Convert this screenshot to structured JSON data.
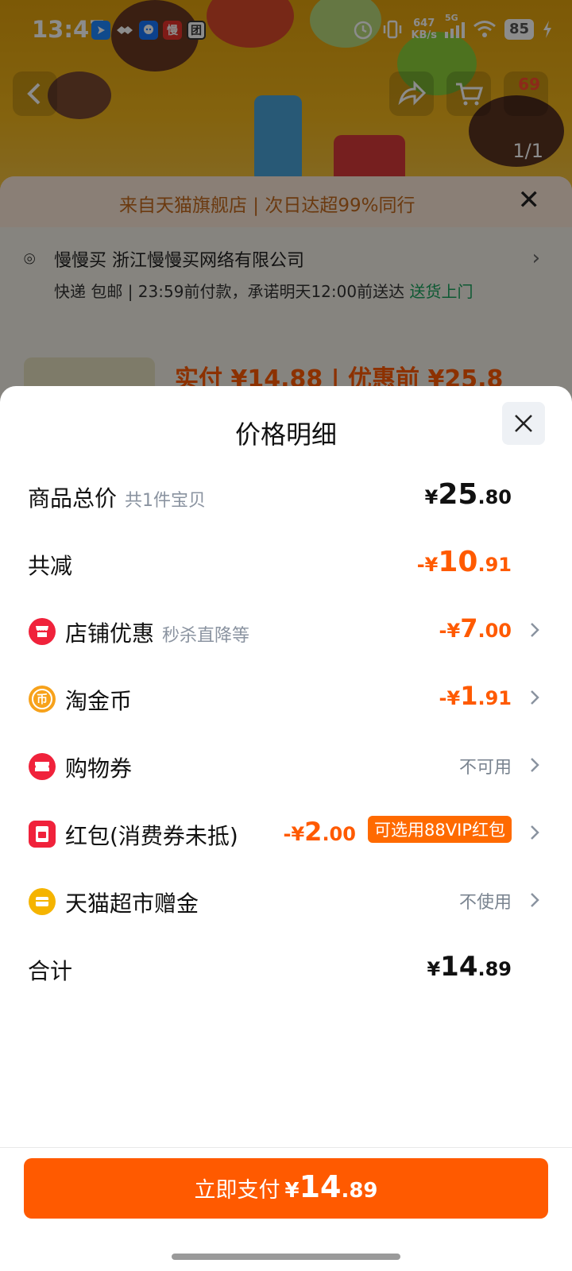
{
  "status_bar": {
    "time": "13:47",
    "net_speed": "647",
    "net_unit": "KB/s",
    "signal": "5G",
    "battery": "85",
    "app_icons": [
      "navigation-icon",
      "handshake-icon",
      "chat-icon",
      "manmanmai-icon",
      "tuan-icon"
    ],
    "app_icon_labels": [
      "慢",
      "团"
    ]
  },
  "background": {
    "pager": "1/1",
    "cart_badge": "69",
    "banner_text": "来自天猫旗舰店 | 次日达超99%同行",
    "address_line": "慢慢买 浙江慢慢买网络有限公司",
    "delivery_prefix": "快递 包邮 | 23:59前付款，承诺明天12:00前送达",
    "delivery_green": "送货上门",
    "price_preview": "实付 ¥14.88 | 优惠前 ¥25.8"
  },
  "sheet": {
    "title": "价格明细",
    "rows": {
      "total": {
        "label": "商品总价",
        "sub": "共1件宝贝",
        "yen": "¥",
        "int": "25",
        "dec": ".80"
      },
      "reduction": {
        "label": "共减",
        "yen": "-¥",
        "int": "10",
        "dec": ".91"
      },
      "shop": {
        "label": "店铺优惠",
        "sub": "秒杀直降等",
        "yen": "-¥",
        "int": "7",
        "dec": ".00",
        "icon": "shop-icon"
      },
      "coins": {
        "label": "淘金币",
        "yen": "-¥",
        "int": "1",
        "dec": ".91",
        "icon": "coin-icon",
        "icon_glyph": "币"
      },
      "voucher": {
        "label": "购物券",
        "value": "不可用",
        "icon": "ticket-icon"
      },
      "redpacket": {
        "label": "红包(消费券未抵)",
        "yen": "-¥",
        "int": "2",
        "dec": ".00",
        "tag": "可选用88VIP红包",
        "icon": "red-packet-icon"
      },
      "gift": {
        "label": "天猫超市赠金",
        "value": "不使用",
        "icon": "gift-card-icon"
      },
      "sum": {
        "label": "合计",
        "yen": "¥",
        "int": "14",
        "dec": ".89"
      }
    }
  },
  "footer": {
    "pay_label": "立即支付",
    "pay_yen": "¥",
    "pay_int": "14",
    "pay_dec": ".89"
  },
  "colors": {
    "accent": "#ff5a00",
    "shop_icon": "#f0223b",
    "coin_icon": "#f7a21b",
    "gift_icon": "#f5b400"
  }
}
